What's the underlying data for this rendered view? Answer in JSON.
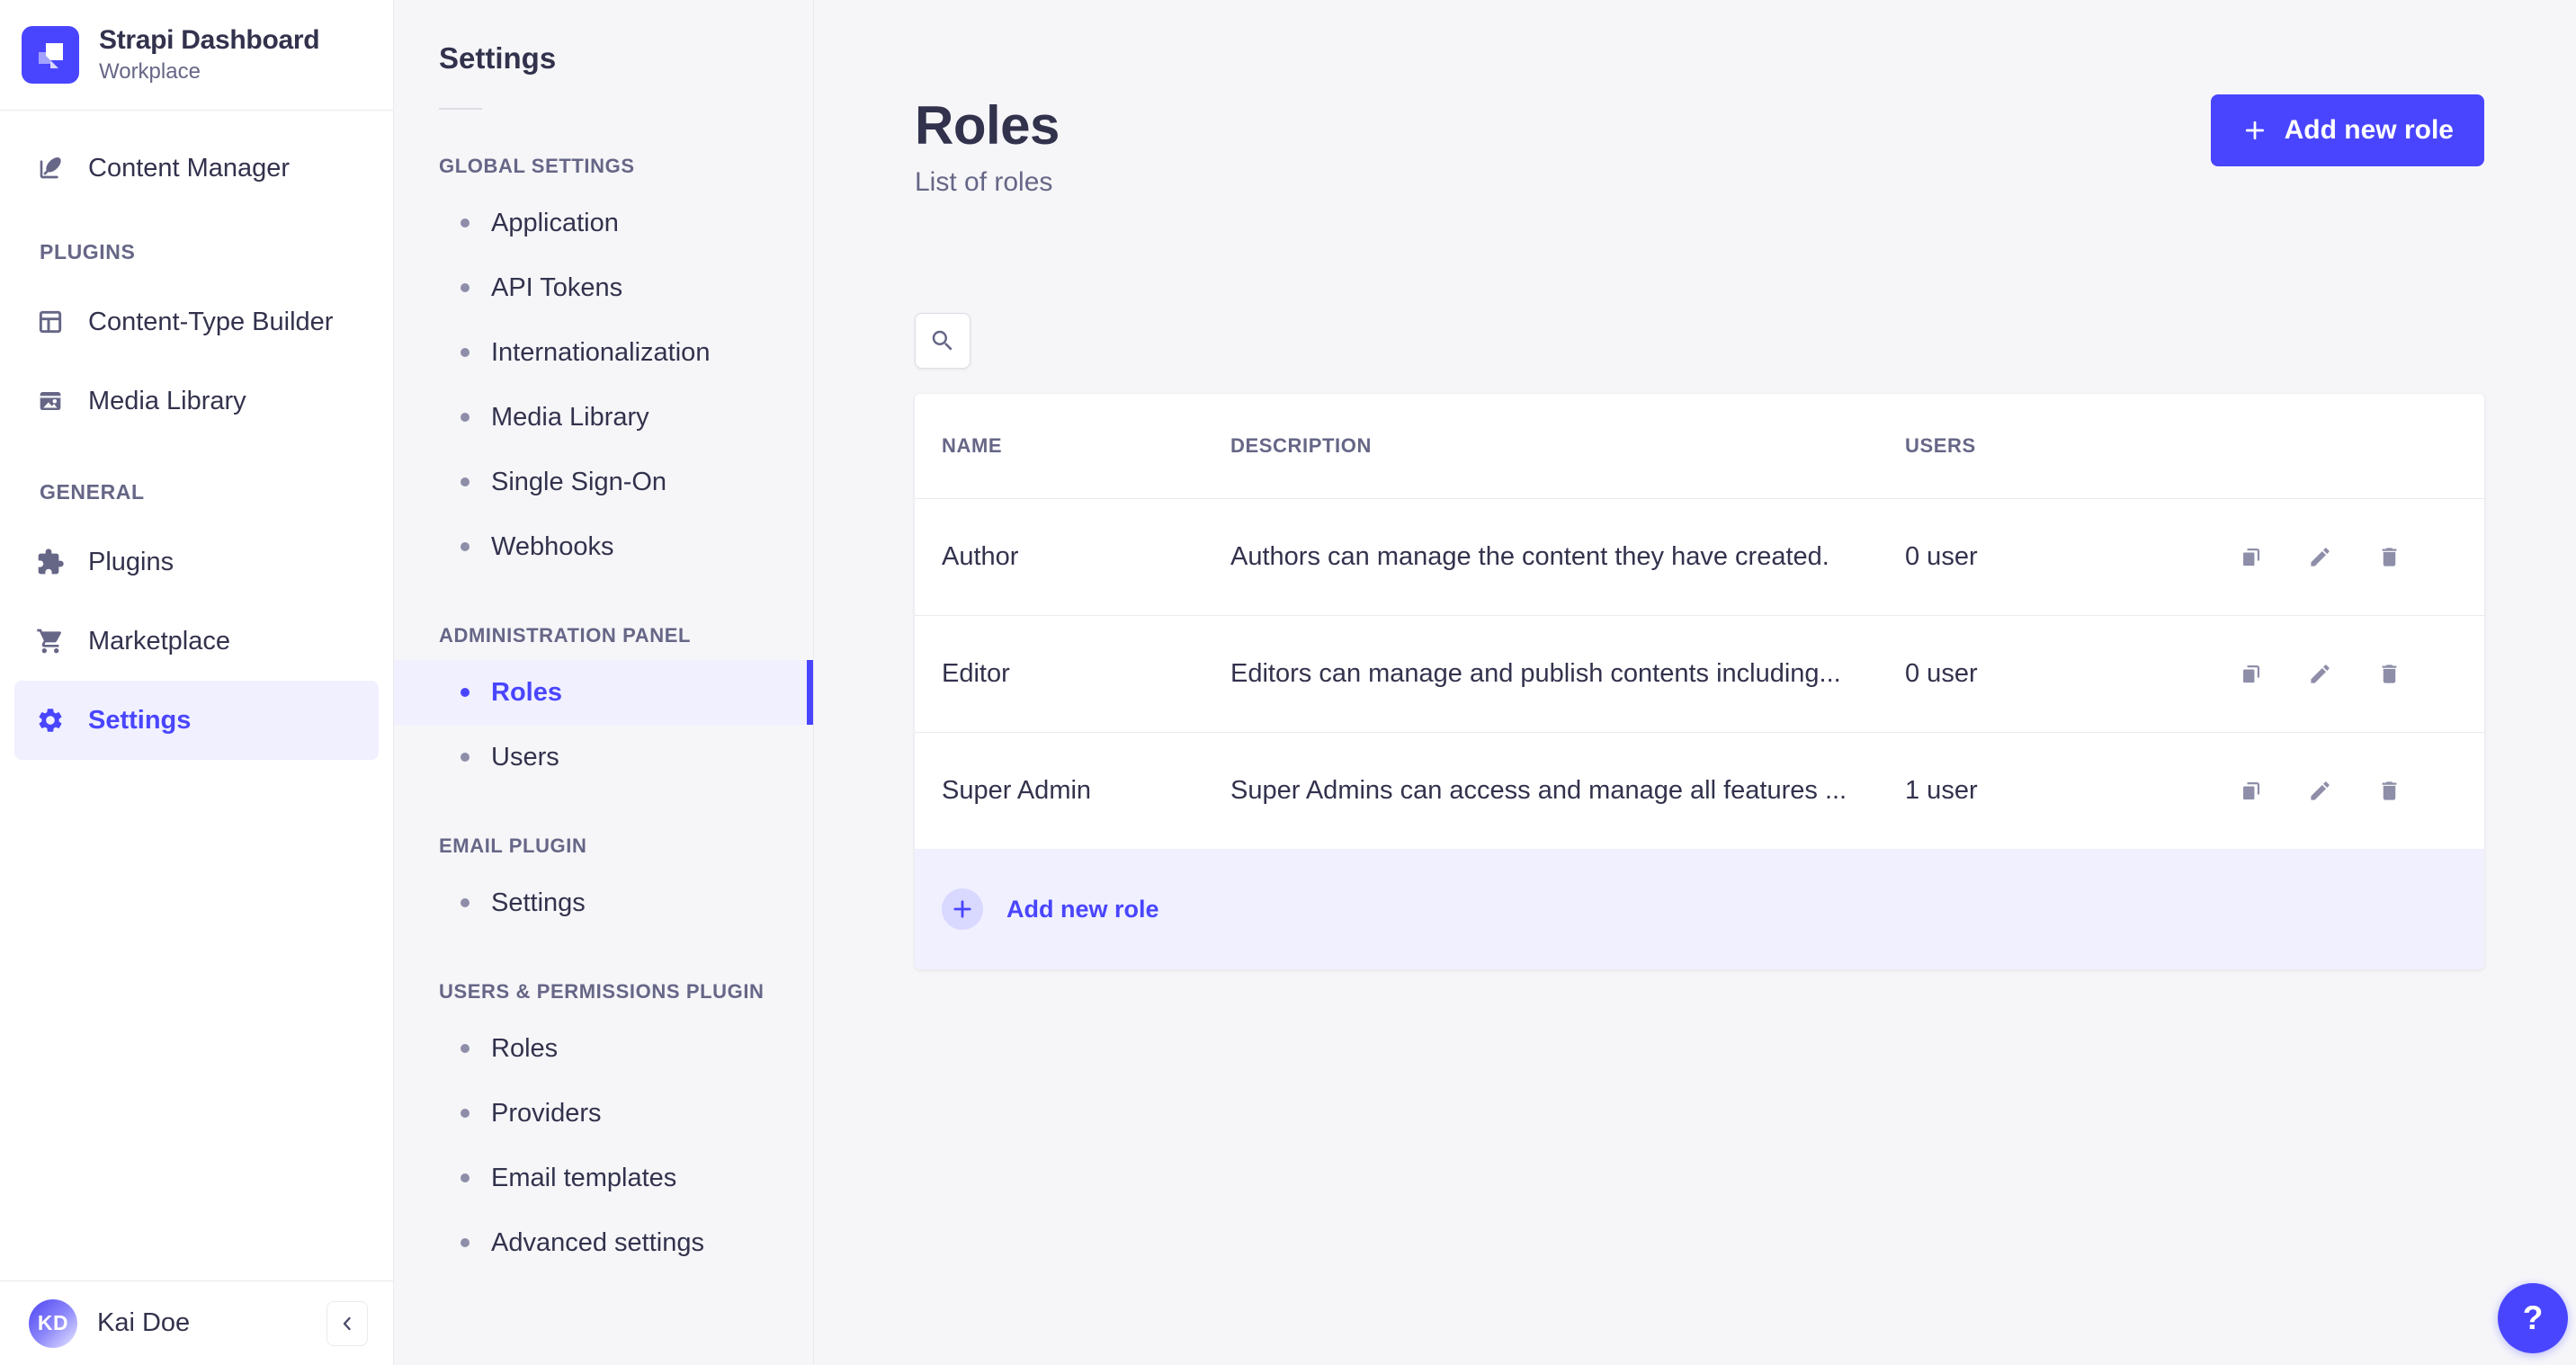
{
  "app": {
    "brand_title": "Strapi Dashboard",
    "brand_subtitle": "Workplace",
    "user": {
      "initials": "KD",
      "name": "Kai Doe"
    },
    "help_label": "?"
  },
  "sidebar": {
    "primary_item": {
      "label": "Content Manager",
      "icon": "feather-pen-icon"
    },
    "sections": [
      {
        "label": "PLUGINS",
        "items": [
          {
            "label": "Content-Type Builder",
            "icon": "layout-icon"
          },
          {
            "label": "Media Library",
            "icon": "picture-icon"
          }
        ]
      },
      {
        "label": "GENERAL",
        "items": [
          {
            "label": "Plugins",
            "icon": "puzzle-icon"
          },
          {
            "label": "Marketplace",
            "icon": "cart-icon"
          },
          {
            "label": "Settings",
            "icon": "gear-icon",
            "active": true
          }
        ]
      }
    ]
  },
  "subnav": {
    "title": "Settings",
    "sections": [
      {
        "label": "GLOBAL SETTINGS",
        "items": [
          {
            "label": "Application"
          },
          {
            "label": "API Tokens"
          },
          {
            "label": "Internationalization"
          },
          {
            "label": "Media Library"
          },
          {
            "label": "Single Sign-On"
          },
          {
            "label": "Webhooks"
          }
        ]
      },
      {
        "label": "ADMINISTRATION PANEL",
        "items": [
          {
            "label": "Roles",
            "active": true
          },
          {
            "label": "Users"
          }
        ]
      },
      {
        "label": "EMAIL PLUGIN",
        "items": [
          {
            "label": "Settings"
          }
        ]
      },
      {
        "label": "USERS & PERMISSIONS PLUGIN",
        "items": [
          {
            "label": "Roles"
          },
          {
            "label": "Providers"
          },
          {
            "label": "Email templates"
          },
          {
            "label": "Advanced settings"
          }
        ]
      }
    ]
  },
  "main": {
    "title": "Roles",
    "subtitle": "List of roles",
    "add_button_label": "Add new role",
    "table": {
      "headers": {
        "name": "NAME",
        "description": "DESCRIPTION",
        "users": "USERS"
      },
      "rows": [
        {
          "name": "Author",
          "description": "Authors can manage the content they have created.",
          "users": "0 user"
        },
        {
          "name": "Editor",
          "description": "Editors can manage and publish contents including...",
          "users": "0 user"
        },
        {
          "name": "Super Admin",
          "description": "Super Admins can access and manage all features ...",
          "users": "1 user"
        }
      ],
      "row_actions": [
        "duplicate-icon",
        "edit-icon",
        "delete-icon"
      ],
      "footer_add_label": "Add new role"
    }
  },
  "colors": {
    "primary": "#4945ff",
    "primary_light_bg": "#f0f0ff",
    "plus_badge_bg": "#d9d8ff",
    "text_dark": "#32324d",
    "text_gray": "#666687",
    "icon_gray": "#8e8ea9",
    "border": "#eaeaef",
    "page_bg": "#f6f6f9"
  }
}
